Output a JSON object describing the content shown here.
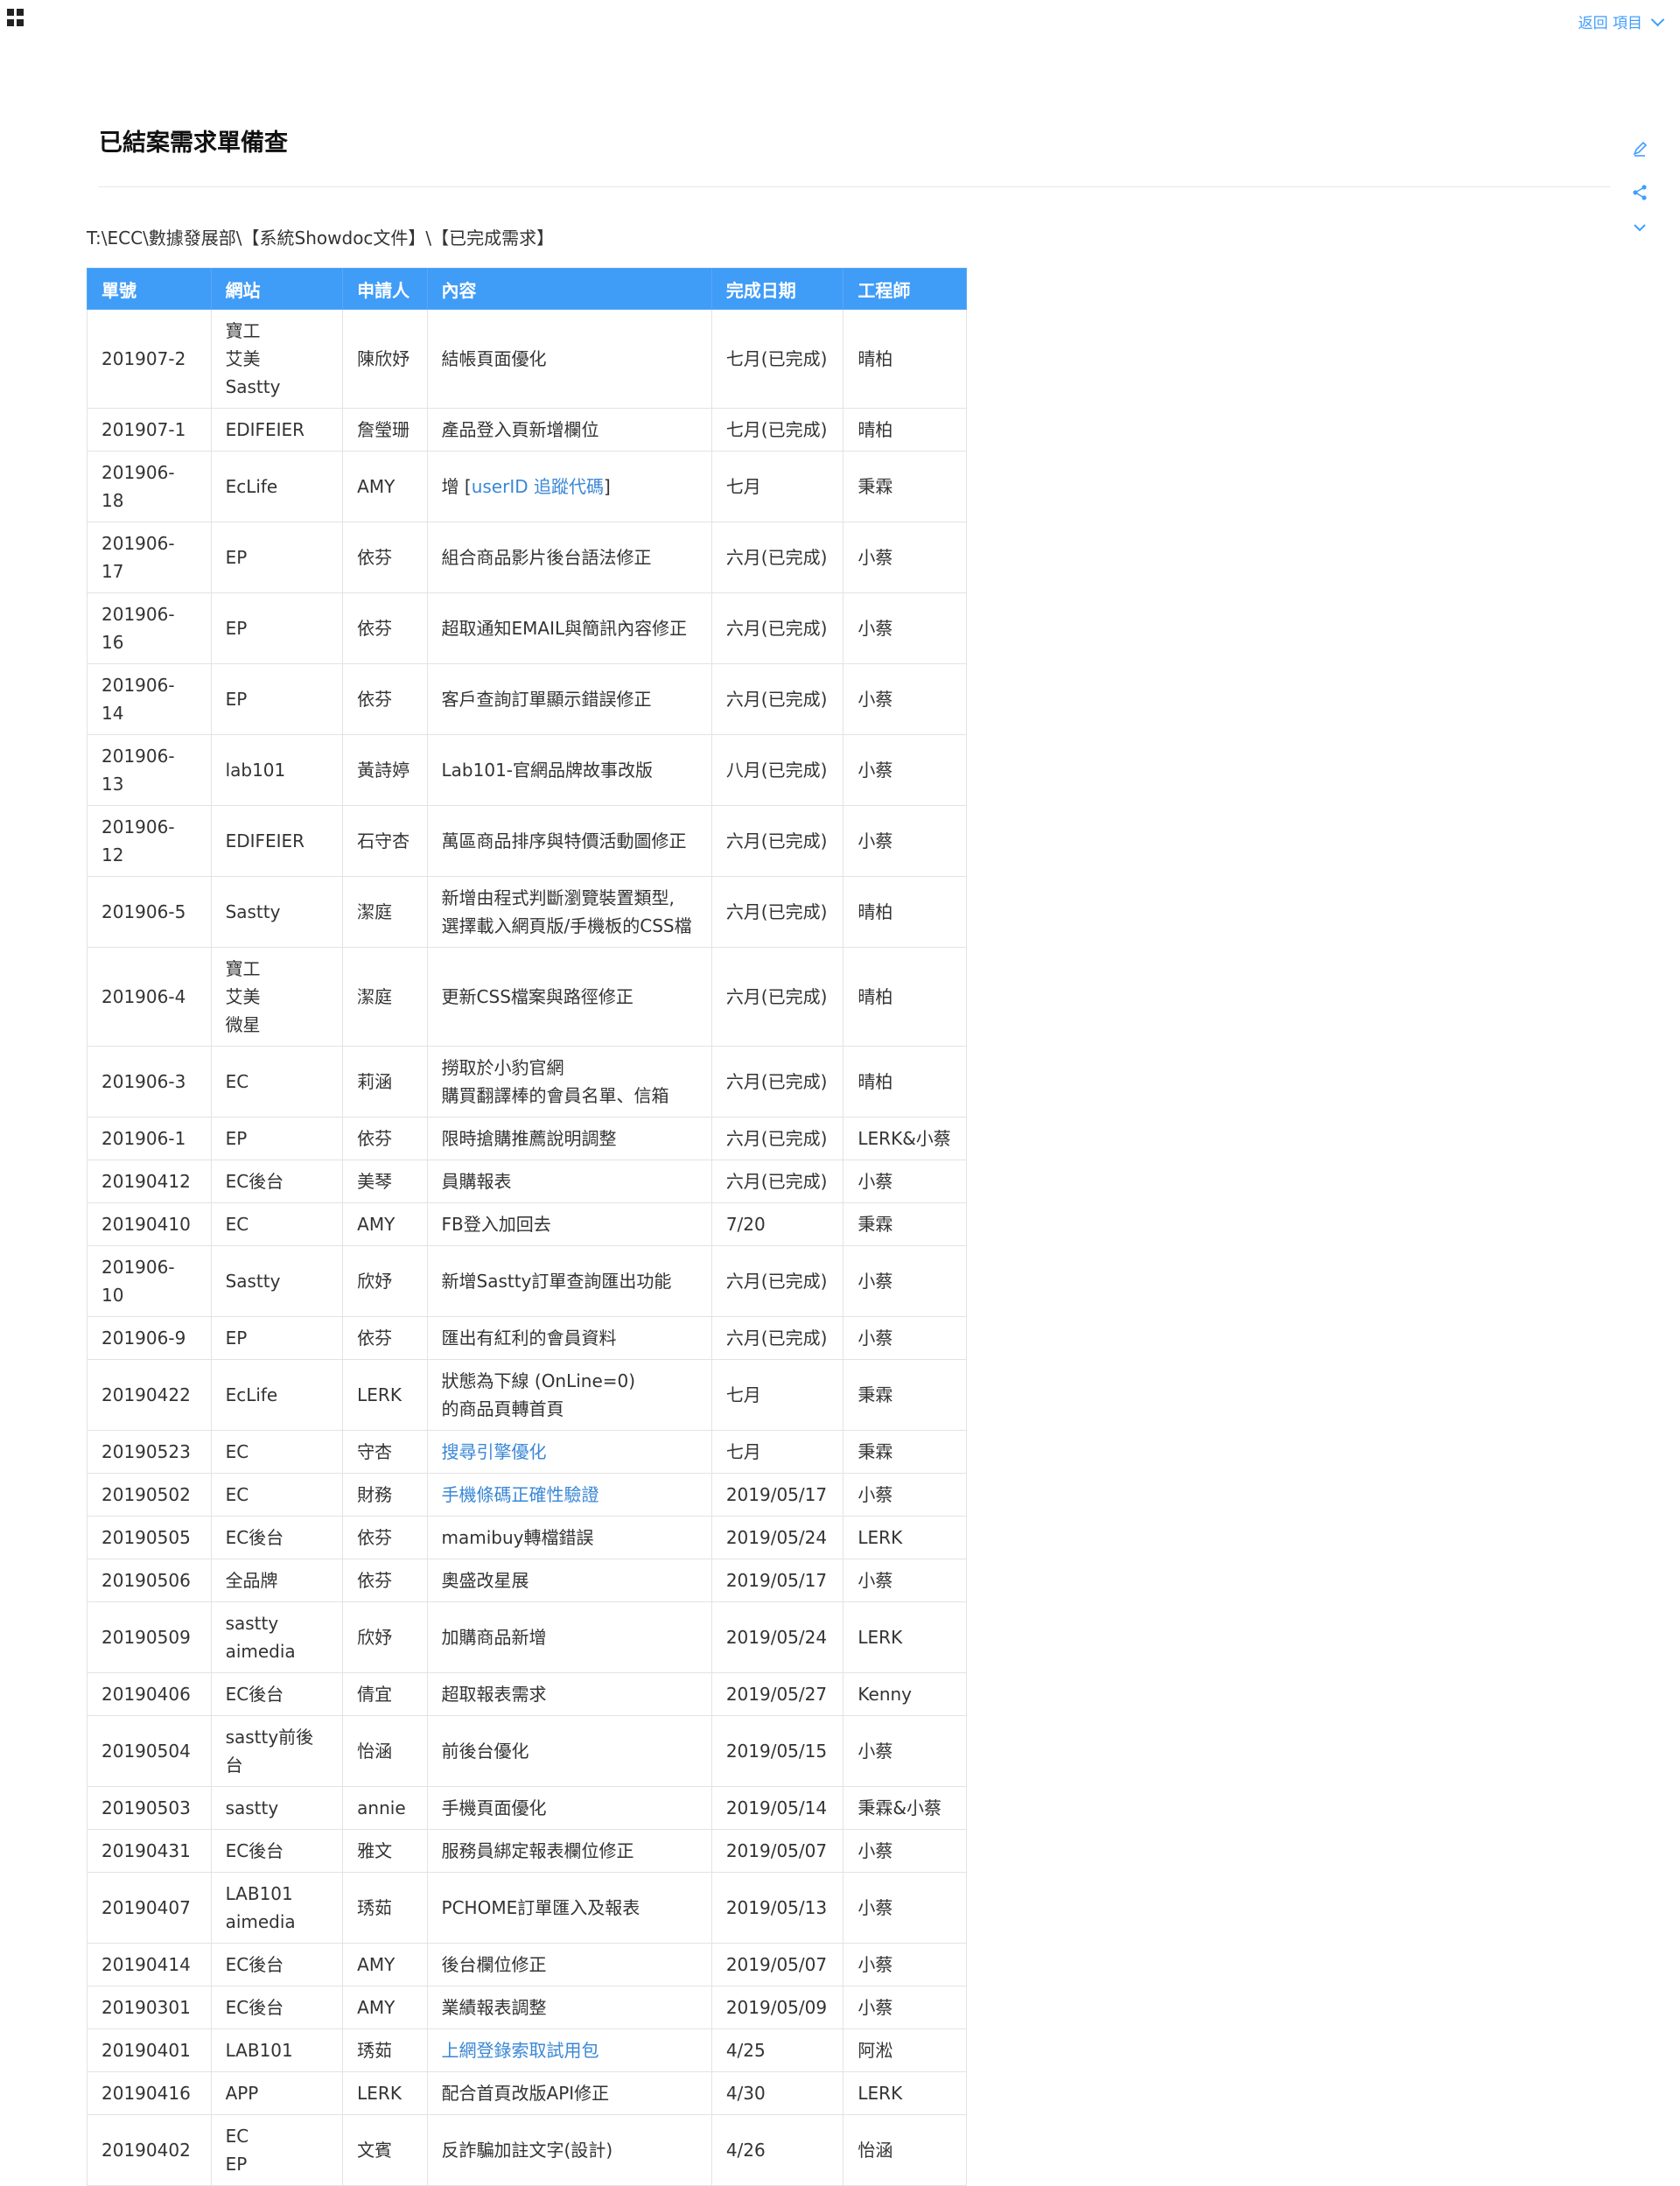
{
  "topbar": {
    "back_label": "返回 項目"
  },
  "title": "已結案需求單備查",
  "path": "T:\\ECC\\數據發展部\\【系統Showdoc文件】\\【已完成需求】",
  "toolbar_icons": [
    "edit-icon",
    "share-icon",
    "chevron-down-icon"
  ],
  "colors": {
    "header_bg": "#3f9cf7",
    "link": "#3a87d6",
    "accent": "#409eff"
  },
  "table": {
    "headers": [
      "單號",
      "網站",
      "申請人",
      "內容",
      "完成日期",
      "工程師"
    ],
    "rows": [
      {
        "id": "201907-2",
        "site": [
          "寶工",
          "艾美",
          "Sastty"
        ],
        "applicant": "陳欣妤",
        "content": [
          {
            "text": "結帳頁面優化"
          }
        ],
        "date": "七月(已完成)",
        "engineer": "晴柏"
      },
      {
        "id": "201907-1",
        "site": [
          "EDIFEIER"
        ],
        "applicant": "詹瑩珊",
        "content": [
          {
            "text": "產品登入頁新增欄位"
          }
        ],
        "date": "七月(已完成)",
        "engineer": "晴柏"
      },
      {
        "id": "201906-18",
        "site": [
          "EcLife"
        ],
        "applicant": "AMY",
        "content": [
          {
            "text": "增 ["
          },
          {
            "text": "userID 追蹤代碼",
            "link": true
          },
          {
            "text": "]"
          }
        ],
        "date": "七月",
        "engineer": "秉霖"
      },
      {
        "id": "201906-17",
        "site": [
          "EP"
        ],
        "applicant": "依芬",
        "content": [
          {
            "text": "組合商品影片後台語法修正"
          }
        ],
        "date": "六月(已完成)",
        "engineer": "小蔡"
      },
      {
        "id": "201906-16",
        "site": [
          "EP"
        ],
        "applicant": "依芬",
        "content": [
          {
            "text": "超取通知EMAIL與簡訊內容修正"
          }
        ],
        "date": "六月(已完成)",
        "engineer": "小蔡"
      },
      {
        "id": "201906-14",
        "site": [
          "EP"
        ],
        "applicant": "依芬",
        "content": [
          {
            "text": "客戶查詢訂單顯示錯誤修正"
          }
        ],
        "date": "六月(已完成)",
        "engineer": "小蔡"
      },
      {
        "id": "201906-13",
        "site": [
          "lab101"
        ],
        "applicant": "黃詩婷",
        "content": [
          {
            "text": "Lab101-官網品牌故事改版"
          }
        ],
        "date": "八月(已完成)",
        "engineer": "小蔡"
      },
      {
        "id": "201906-12",
        "site": [
          "EDIFEIER"
        ],
        "applicant": "石守杏",
        "content": [
          {
            "text": "萬區商品排序與特價活動圖修正"
          }
        ],
        "date": "六月(已完成)",
        "engineer": "小蔡"
      },
      {
        "id": "201906-5",
        "site": [
          "Sastty"
        ],
        "applicant": "潔庭",
        "content": [
          {
            "text": "新增由程式判斷瀏覽裝置類型,",
            "br": true
          },
          {
            "text": "選擇載入網頁版/手機板的CSS檔"
          }
        ],
        "date": "六月(已完成)",
        "engineer": "晴柏"
      },
      {
        "id": "201906-4",
        "site": [
          "寶工",
          "艾美",
          "微星"
        ],
        "applicant": "潔庭",
        "content": [
          {
            "text": "更新CSS檔案與路徑修正"
          }
        ],
        "date": "六月(已完成)",
        "engineer": "晴柏"
      },
      {
        "id": "201906-3",
        "site": [
          "EC"
        ],
        "applicant": "莉涵",
        "content": [
          {
            "text": "撈取於小豹官網",
            "br": true
          },
          {
            "text": "購買翻譯棒的會員名單、信箱"
          }
        ],
        "date": "六月(已完成)",
        "engineer": "晴柏"
      },
      {
        "id": "201906-1",
        "site": [
          "EP"
        ],
        "applicant": "依芬",
        "content": [
          {
            "text": "限時搶購推薦說明調整"
          }
        ],
        "date": "六月(已完成)",
        "engineer": "LERK&小蔡"
      },
      {
        "id": "20190412",
        "site": [
          "EC後台"
        ],
        "applicant": "美琴",
        "content": [
          {
            "text": "員購報表"
          }
        ],
        "date": "六月(已完成)",
        "engineer": "小蔡"
      },
      {
        "id": "20190410",
        "site": [
          "EC"
        ],
        "applicant": "AMY",
        "content": [
          {
            "text": "FB登入加回去"
          }
        ],
        "date": "7/20",
        "engineer": "秉霖"
      },
      {
        "id": "201906-10",
        "site": [
          "Sastty"
        ],
        "applicant": "欣妤",
        "content": [
          {
            "text": "新增Sastty訂單查詢匯出功能"
          }
        ],
        "date": "六月(已完成)",
        "engineer": "小蔡"
      },
      {
        "id": "201906-9",
        "site": [
          "EP"
        ],
        "applicant": "依芬",
        "content": [
          {
            "text": "匯出有紅利的會員資料"
          }
        ],
        "date": "六月(已完成)",
        "engineer": "小蔡"
      },
      {
        "id": "20190422",
        "site": [
          "EcLife"
        ],
        "applicant": "LERK",
        "content": [
          {
            "text": "狀態為下線 (OnLine=0)",
            "br": true
          },
          {
            "text": "的商品頁轉首頁"
          }
        ],
        "date": "七月",
        "engineer": "秉霖"
      },
      {
        "id": "20190523",
        "site": [
          "EC"
        ],
        "applicant": "守杏",
        "content": [
          {
            "text": "搜尋引擎優化",
            "link": true
          }
        ],
        "date": "七月",
        "engineer": "秉霖"
      },
      {
        "id": "20190502",
        "site": [
          "EC"
        ],
        "applicant": "財務",
        "content": [
          {
            "text": "手機條碼正確性驗證",
            "link": true
          }
        ],
        "date": "2019/05/17",
        "engineer": "小蔡"
      },
      {
        "id": "20190505",
        "site": [
          "EC後台"
        ],
        "applicant": "依芬",
        "content": [
          {
            "text": "mamibuy轉檔錯誤"
          }
        ],
        "date": "2019/05/24",
        "engineer": "LERK"
      },
      {
        "id": "20190506",
        "site": [
          "全品牌"
        ],
        "applicant": "依芬",
        "content": [
          {
            "text": "奧盛改星展"
          }
        ],
        "date": "2019/05/17",
        "engineer": "小蔡"
      },
      {
        "id": "20190509",
        "site": [
          "sastty",
          "aimedia"
        ],
        "applicant": "欣妤",
        "content": [
          {
            "text": "加購商品新增"
          }
        ],
        "date": "2019/05/24",
        "engineer": "LERK"
      },
      {
        "id": "20190406",
        "site": [
          "EC後台"
        ],
        "applicant": "倩宜",
        "content": [
          {
            "text": "超取報表需求"
          }
        ],
        "date": "2019/05/27",
        "engineer": "Kenny"
      },
      {
        "id": "20190504",
        "site": [
          "sastty前後台"
        ],
        "applicant": "怡涵",
        "content": [
          {
            "text": "前後台優化"
          }
        ],
        "date": "2019/05/15",
        "engineer": "小蔡"
      },
      {
        "id": "20190503",
        "site": [
          "sastty"
        ],
        "applicant": "annie",
        "content": [
          {
            "text": "手機頁面優化"
          }
        ],
        "date": "2019/05/14",
        "engineer": "秉霖&小蔡"
      },
      {
        "id": "20190431",
        "site": [
          "EC後台"
        ],
        "applicant": "雅文",
        "content": [
          {
            "text": "服務員綁定報表欄位修正"
          }
        ],
        "date": "2019/05/07",
        "engineer": "小蔡"
      },
      {
        "id": "20190407",
        "site": [
          "LAB101",
          "aimedia"
        ],
        "applicant": "琇茹",
        "content": [
          {
            "text": "PCHOME訂單匯入及報表"
          }
        ],
        "date": "2019/05/13",
        "engineer": "小蔡"
      },
      {
        "id": "20190414",
        "site": [
          "EC後台"
        ],
        "applicant": "AMY",
        "content": [
          {
            "text": "後台欄位修正"
          }
        ],
        "date": "2019/05/07",
        "engineer": "小蔡"
      },
      {
        "id": "20190301",
        "site": [
          "EC後台"
        ],
        "applicant": "AMY",
        "content": [
          {
            "text": "業績報表調整"
          }
        ],
        "date": "2019/05/09",
        "engineer": "小蔡"
      },
      {
        "id": "20190401",
        "site": [
          "LAB101"
        ],
        "applicant": "琇茹",
        "content": [
          {
            "text": "上網登錄索取試用包",
            "link": true
          }
        ],
        "date": "4/25",
        "engineer": "阿淞"
      },
      {
        "id": "20190416",
        "site": [
          "APP"
        ],
        "applicant": "LERK",
        "content": [
          {
            "text": "配合首頁改版API修正"
          }
        ],
        "date": "4/30",
        "engineer": "LERK"
      },
      {
        "id": "20190402",
        "site": [
          "EC",
          "EP"
        ],
        "applicant": "文賓",
        "content": [
          {
            "text": "反詐騙加註文字(設計)"
          }
        ],
        "date": "4/26",
        "engineer": "怡涵"
      }
    ]
  }
}
